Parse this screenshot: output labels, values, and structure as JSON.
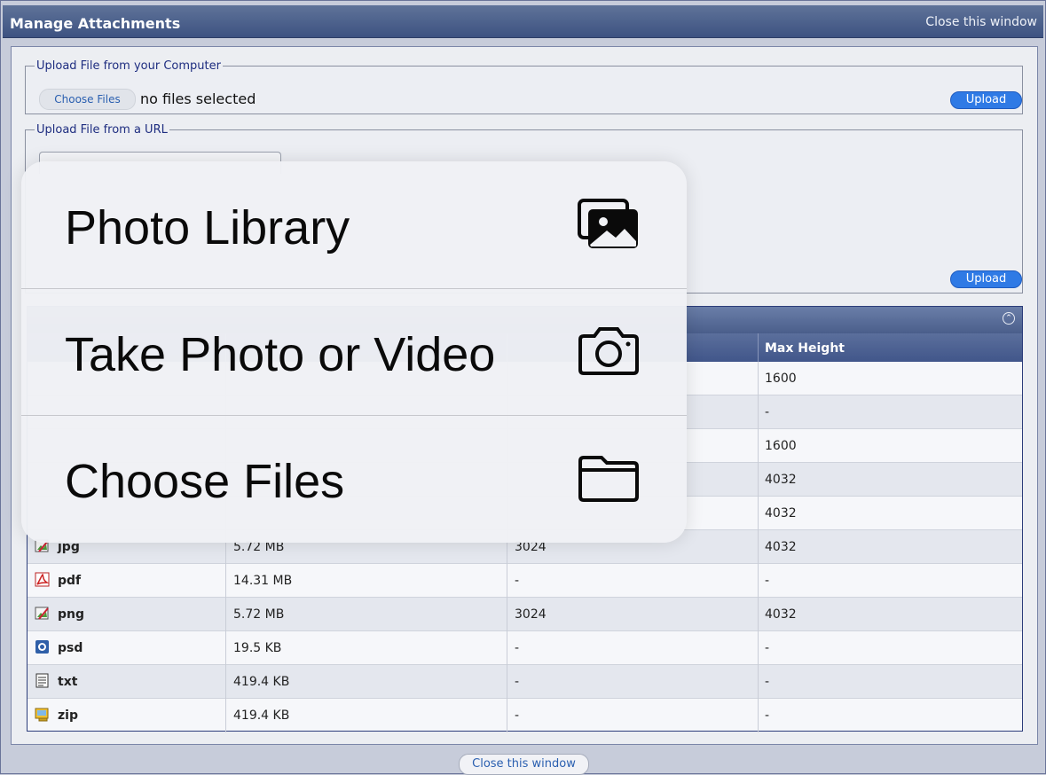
{
  "window": {
    "title": "Manage Attachments",
    "close_top": "Close this window",
    "close_bottom": "Close this window"
  },
  "upload_computer": {
    "legend": "Upload File from your Computer",
    "choose_label": "Choose Files",
    "status": "no files selected",
    "upload_label": "Upload"
  },
  "upload_url": {
    "legend": "Upload File from a URL",
    "url_value": "",
    "upload_label": "Upload"
  },
  "table": {
    "headers": [
      "",
      "",
      "",
      "Max Height"
    ],
    "rows": [
      {
        "type": "",
        "size": "",
        "width": "",
        "height": "1600"
      },
      {
        "type": "",
        "size": "",
        "width": "",
        "height": "-"
      },
      {
        "type": "",
        "size": "",
        "width": "",
        "height": "1600"
      },
      {
        "type": "",
        "size": "",
        "width": "",
        "height": "4032"
      },
      {
        "type": "",
        "size": "",
        "width": "",
        "height": "4032"
      },
      {
        "type": "jpg",
        "size": "5.72 MB",
        "width": "3024",
        "height": "4032",
        "icon": "image-edit-icon"
      },
      {
        "type": "pdf",
        "size": "14.31 MB",
        "width": "-",
        "height": "-",
        "icon": "pdf-icon"
      },
      {
        "type": "png",
        "size": "5.72 MB",
        "width": "3024",
        "height": "4032",
        "icon": "image-edit-icon"
      },
      {
        "type": "psd",
        "size": "19.5 KB",
        "width": "-",
        "height": "-",
        "icon": "psd-icon"
      },
      {
        "type": "txt",
        "size": "419.4 KB",
        "width": "-",
        "height": "-",
        "icon": "text-file-icon"
      },
      {
        "type": "zip",
        "size": "419.4 KB",
        "width": "-",
        "height": "-",
        "icon": "zip-icon"
      }
    ]
  },
  "picker_menu": {
    "items": [
      {
        "label": "Photo Library",
        "icon": "photo-library-icon"
      },
      {
        "label": "Take Photo or Video",
        "icon": "camera-icon"
      },
      {
        "label": "Choose Files",
        "icon": "folder-icon"
      }
    ]
  },
  "colors": {
    "title_bar": "#4a5e8b",
    "button_blue": "#2f7ae5",
    "link_blue": "#2a5fb0"
  }
}
